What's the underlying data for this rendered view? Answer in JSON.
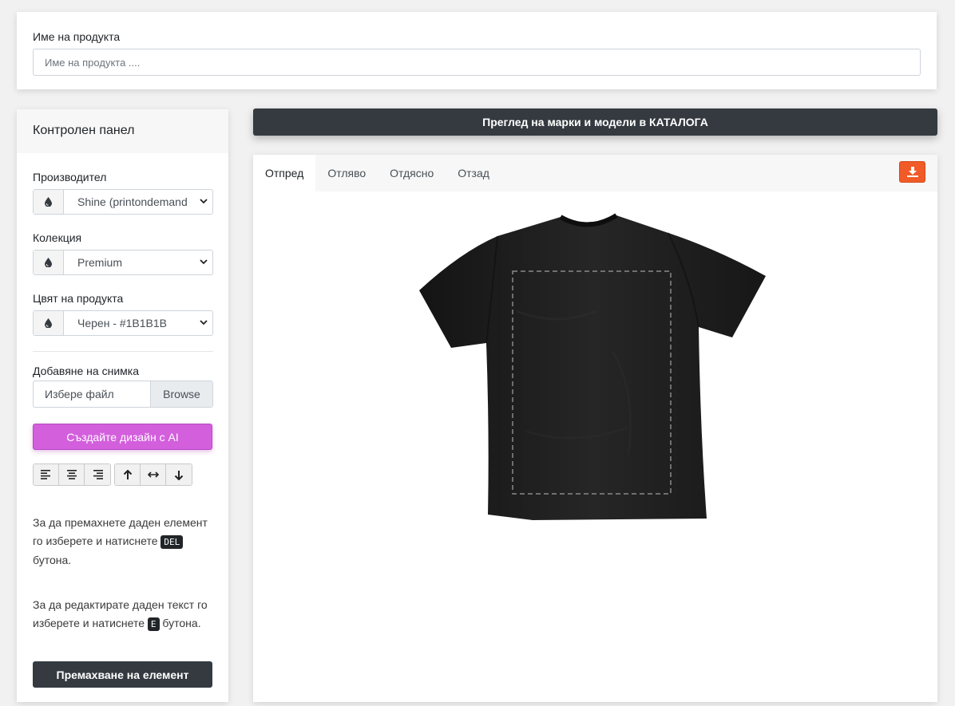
{
  "product_name": {
    "label": "Име на продукта",
    "placeholder": "Име на продукта ...."
  },
  "control_panel": {
    "title": "Контролен панел",
    "manufacturer": {
      "label": "Производител",
      "value": "Shine (printondemand"
    },
    "collection": {
      "label": "Колекция",
      "value": "Premium"
    },
    "product_color": {
      "label": "Цвят на продукта",
      "value": "Черен - #1B1B1B"
    },
    "upload": {
      "label": "Добавяне на снимка",
      "placeholder": "Избере файл",
      "browse": "Browse"
    },
    "ai_button": "Създайте дизайн с AI",
    "info_delete": {
      "before": "За да премахнете даден елемент го изберете и натиснете",
      "key": "DEL",
      "after": "бутона."
    },
    "info_edit": {
      "before": "За да редактирате даден текст го изберете и натиснете",
      "key": "E",
      "after": "бутона."
    },
    "remove_button": "Премахване на елемент"
  },
  "catalog_button": "Преглед на марки и модели в КАТАЛОГА",
  "preview": {
    "tabs": [
      "Отпред",
      "Отляво",
      "Отдясно",
      "Отзад"
    ],
    "active_tab": "Отпред",
    "product_color_hex": "#1B1B1B",
    "accent_download": "#F05B28"
  }
}
